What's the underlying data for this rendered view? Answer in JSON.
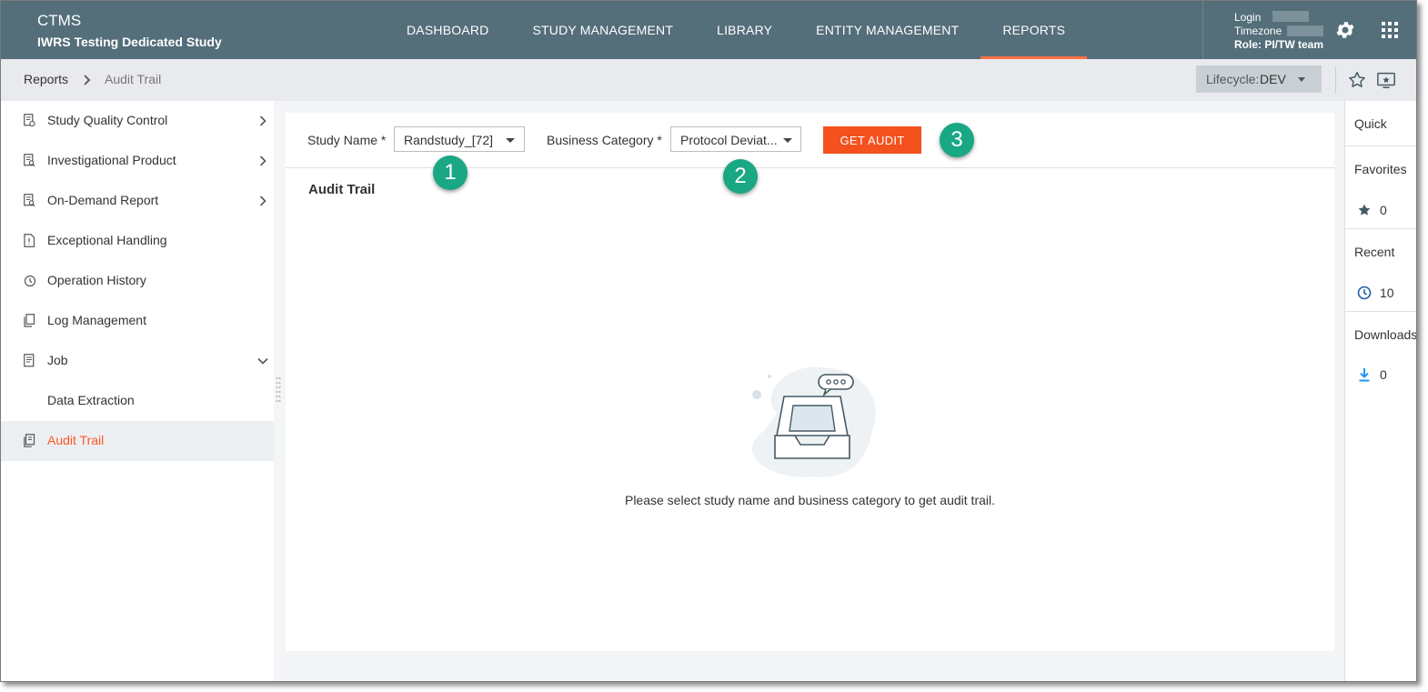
{
  "header": {
    "app_name": "CTMS",
    "study_name": "IWRS Testing Dedicated Study",
    "nav": [
      {
        "label": "DASHBOARD"
      },
      {
        "label": "STUDY MANAGEMENT"
      },
      {
        "label": "LIBRARY"
      },
      {
        "label": "ENTITY MANAGEMENT"
      },
      {
        "label": "REPORTS",
        "active": true
      }
    ],
    "user": {
      "login_label": "Login",
      "timezone_label": "Timezone",
      "role_text": "Role: PI/TW team"
    },
    "icons": [
      "gear-icon",
      "apps-grid-icon"
    ],
    "bg_color": "#546e7a",
    "active_underline_color": "#ff7043"
  },
  "breadcrumb": {
    "items": [
      "Reports",
      "Audit Trail"
    ],
    "lifecycle_label": "Lifecycle:",
    "lifecycle_value": "DEV"
  },
  "sidebar": {
    "items": [
      {
        "label": "Study Quality Control",
        "icon": "report-check-icon",
        "chevron": "right"
      },
      {
        "label": "Investigational Product",
        "icon": "report-search-icon",
        "chevron": "right"
      },
      {
        "label": "On-Demand Report",
        "icon": "report-search-icon",
        "chevron": "right"
      },
      {
        "label": "Exceptional Handling",
        "icon": "file-warning-icon"
      },
      {
        "label": "Operation History",
        "icon": "history-icon"
      },
      {
        "label": "Log Management",
        "icon": "copy-icon"
      },
      {
        "label": "Job",
        "icon": "document-icon",
        "chevron": "down"
      },
      {
        "label": "Data Extraction"
      },
      {
        "label": "Audit Trail",
        "icon": "audit-icon",
        "active": true
      }
    ],
    "active_color": "#ff5722"
  },
  "filters": {
    "study_label": "Study Name *",
    "study_value": "Randstudy_[72]",
    "category_label": "Business Category *",
    "category_value": "Protocol Deviat...",
    "get_audit_label": "GET AUDIT",
    "button_color": "#f4511e"
  },
  "main": {
    "section_title": "Audit Trail",
    "empty_message": "Please select study name and business category to get audit trail."
  },
  "markers": [
    "1",
    "2",
    "3"
  ],
  "marker_color": "#1aa783",
  "quick": {
    "title": "Quick",
    "favorites_label": "Favorites",
    "favorites_count": "0",
    "recent_label": "Recent",
    "recent_count": "10",
    "downloads_label": "Downloads",
    "downloads_count": "0"
  }
}
